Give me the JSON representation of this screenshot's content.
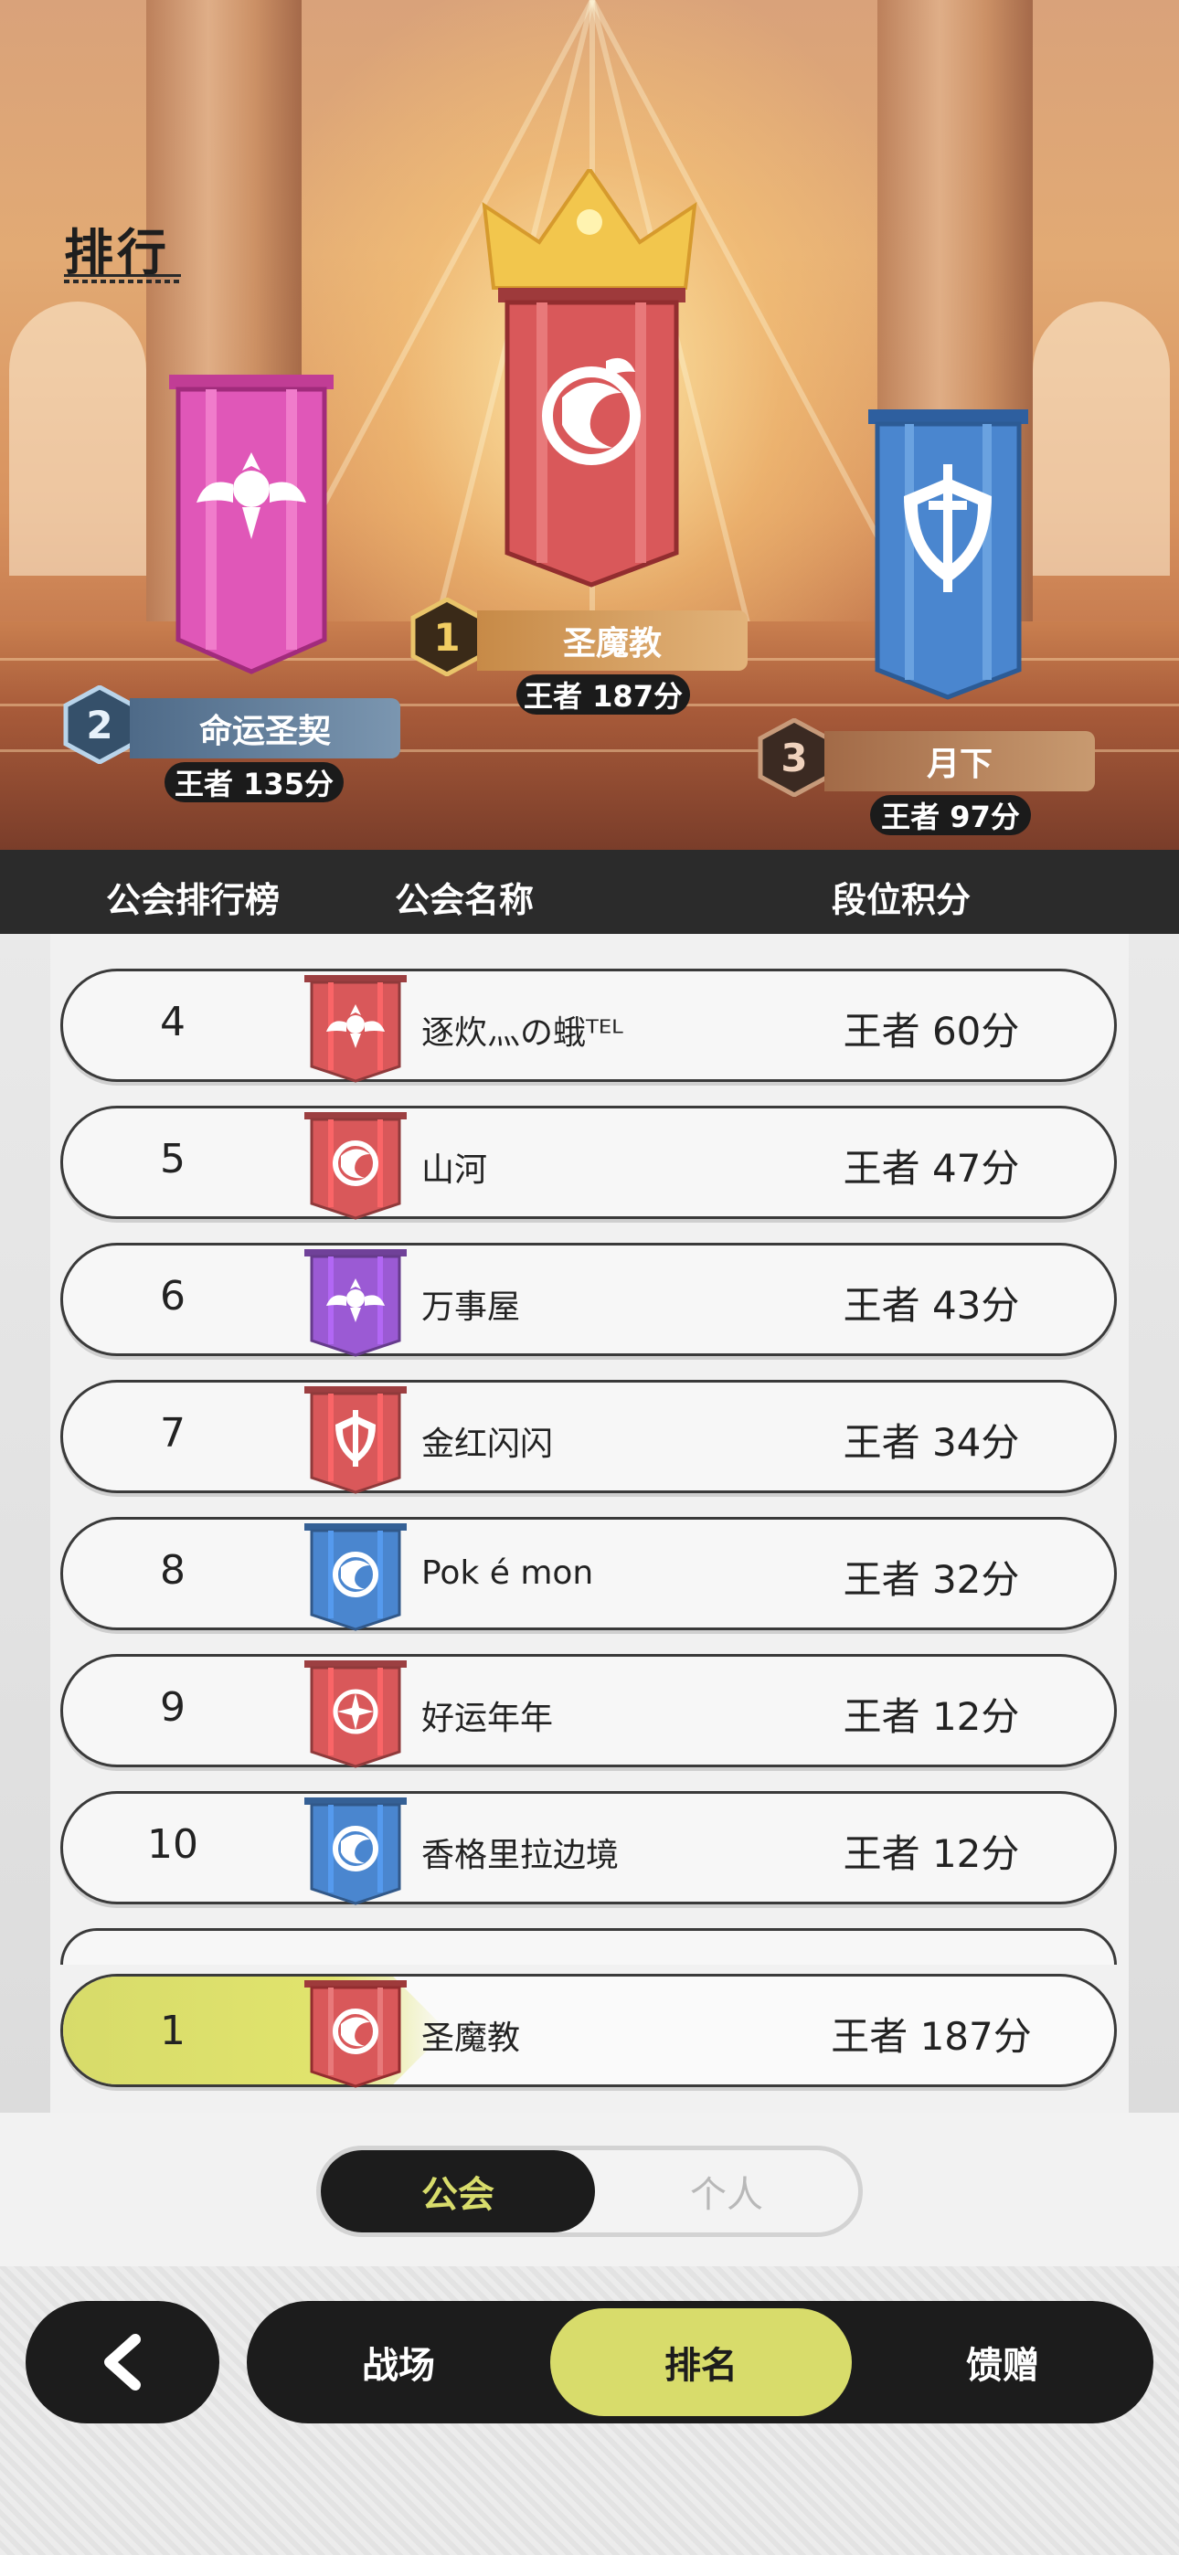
{
  "page": {
    "title": "排行"
  },
  "podium": [
    {
      "rank": "1",
      "guild": "圣魔教",
      "score": "王者 187分",
      "banner_color": "#d9585a",
      "emblem": "dragon-emblem-icon"
    },
    {
      "rank": "2",
      "guild": "命运圣契",
      "score": "王者 135分",
      "banner_color": "#e057b8",
      "emblem": "crown-wings-emblem-icon"
    },
    {
      "rank": "3",
      "guild": "月下",
      "score": "王者 97分",
      "banner_color": "#4a86cf",
      "emblem": "shield-sword-emblem-icon"
    }
  ],
  "table": {
    "headers": {
      "rank": "公会排行榜",
      "name": "公会名称",
      "score": "段位积分"
    },
    "rows": [
      {
        "rank": "4",
        "name": "逐炊灬の蛾ᵀᴱᴸ",
        "score": "王者 60分",
        "banner_color": "#d9585a",
        "emblem": "crown-wings-emblem-icon"
      },
      {
        "rank": "5",
        "name": "山河",
        "score": "王者 47分",
        "banner_color": "#d9585a",
        "emblem": "dragon-emblem-icon"
      },
      {
        "rank": "6",
        "name": "万事屋",
        "score": "王者 43分",
        "banner_color": "#9b5ad4",
        "emblem": "crown-wings-emblem-icon"
      },
      {
        "rank": "7",
        "name": "金红闪闪",
        "score": "王者 34分",
        "banner_color": "#d9585a",
        "emblem": "shield-sword-emblem-icon"
      },
      {
        "rank": "8",
        "name": "Pok é mon",
        "score": "王者 32分",
        "banner_color": "#4a86cf",
        "emblem": "dragon-emblem-icon"
      },
      {
        "rank": "9",
        "name": "好运年年",
        "score": "王者 12分",
        "banner_color": "#d9585a",
        "emblem": "compass-emblem-icon"
      },
      {
        "rank": "10",
        "name": "香格里拉边境",
        "score": "王者 12分",
        "banner_color": "#4a86cf",
        "emblem": "dragon-emblem-icon"
      }
    ],
    "self": {
      "rank": "1",
      "name": "圣魔教",
      "score": "王者 187分",
      "banner_color": "#d9585a",
      "emblem": "dragon-emblem-icon"
    }
  },
  "segment": {
    "active": "公会",
    "inactive": "个人"
  },
  "nav": {
    "back_icon": "chevron-left-icon",
    "items": [
      "战场",
      "排名",
      "馈赠"
    ],
    "active_index": 1
  },
  "colors": {
    "accent": "#d8dc6b",
    "dark": "#1c1c1c"
  }
}
